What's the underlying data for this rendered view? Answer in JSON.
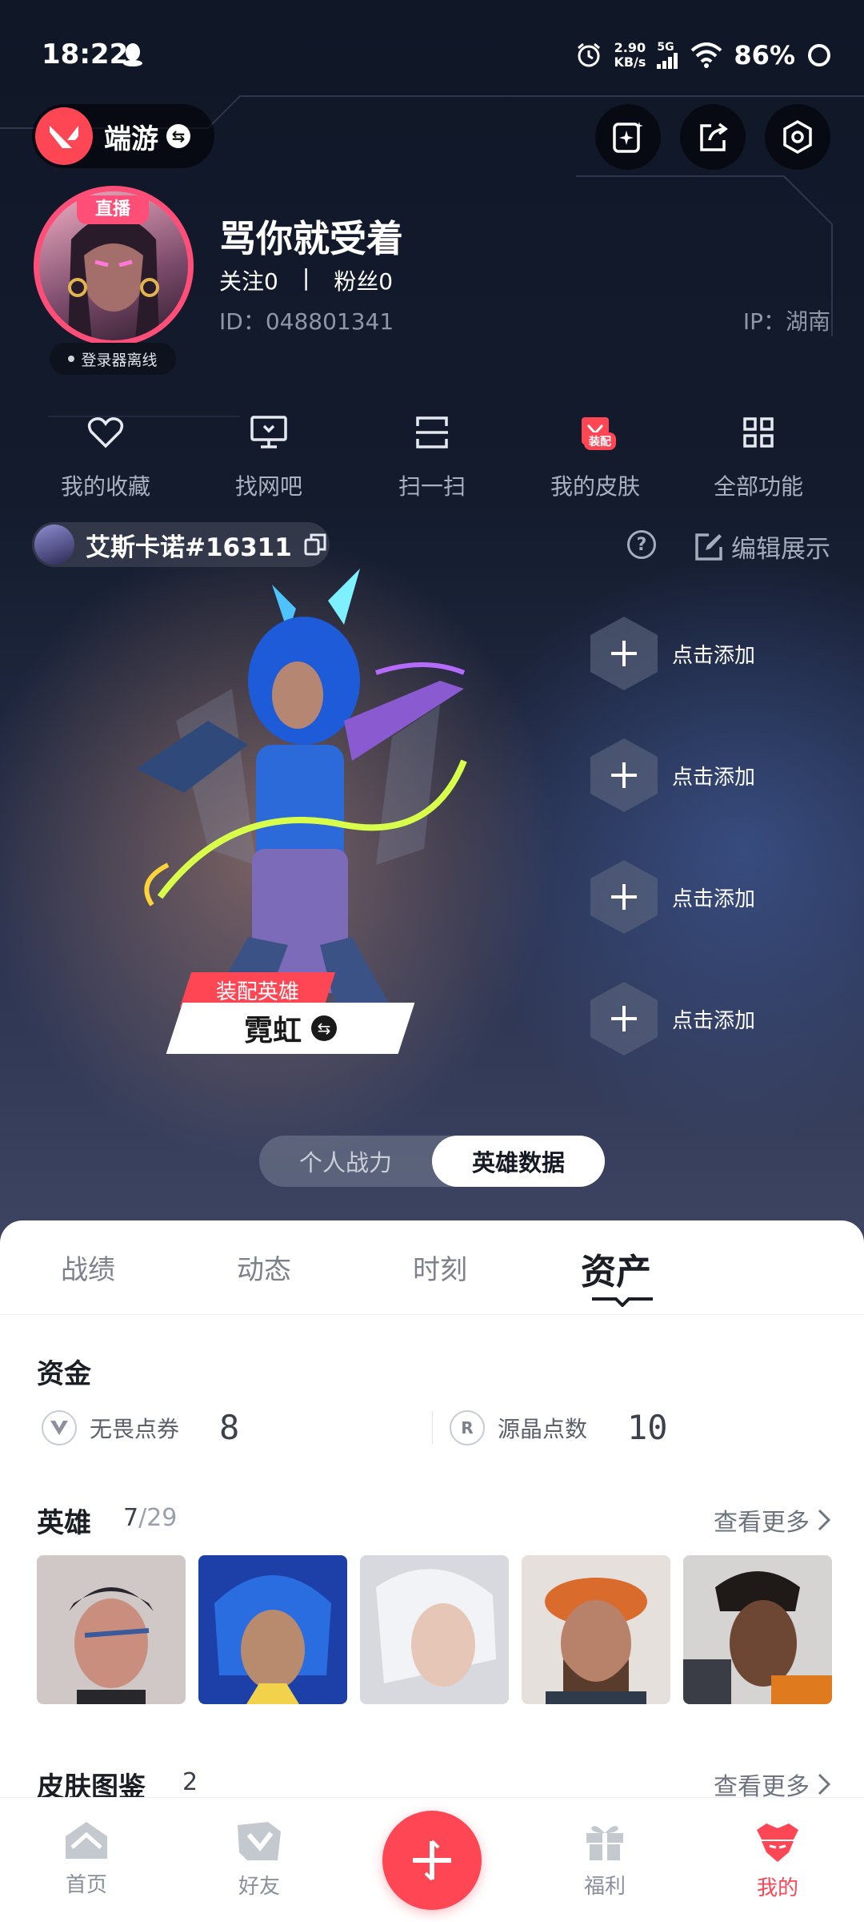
{
  "status_bar": {
    "time": "18:22",
    "speed_top": "2.90",
    "speed_unit": "KB/s",
    "network": "5G",
    "battery": "86%"
  },
  "header": {
    "app_name": "端游"
  },
  "profile": {
    "live_badge": "直播",
    "launcher_status": "登录器离线",
    "nickname": "骂你就受着",
    "following": "关注0",
    "separator": "|",
    "fans": "粉丝0",
    "uid": "ID：048801341",
    "ip": "IP：湖南"
  },
  "shortcuts": [
    {
      "label": "我的收藏",
      "icon": "heart-icon"
    },
    {
      "label": "找网吧",
      "icon": "monitor-icon"
    },
    {
      "label": "扫一扫",
      "icon": "scan-icon"
    },
    {
      "label": "我的皮肤",
      "icon": "skin-icon",
      "badge": "装配"
    },
    {
      "label": "全部功能",
      "icon": "grid-icon"
    }
  ],
  "account": {
    "riot_id": "艾斯卡诺#16311",
    "edit_label": "编辑展示"
  },
  "showcase": {
    "equip_label": "装配英雄",
    "agent_name": "霓虹",
    "slots": [
      "点击添加",
      "点击添加",
      "点击添加",
      "点击添加"
    ]
  },
  "toggle": {
    "left": "个人战力",
    "right": "英雄数据"
  },
  "tabs": [
    "战绩",
    "动态",
    "时刻",
    "资产"
  ],
  "assets": {
    "funds_title": "资金",
    "funds": [
      {
        "icon": "valorant-points-icon",
        "label": "无畏点券",
        "value": "8"
      },
      {
        "icon": "radianite-icon",
        "label": "源晶点数",
        "value": "10"
      }
    ],
    "heroes_title": "英雄",
    "heroes_owned": "7",
    "heroes_sep": "/",
    "heroes_total": "29",
    "more_label": "查看更多",
    "skins_title": "皮肤图鉴",
    "skins_count": "2"
  },
  "bottom_nav": [
    {
      "label": "首页",
      "icon": "home-icon"
    },
    {
      "label": "好友",
      "icon": "friends-icon"
    },
    {
      "label": "福利",
      "icon": "gift-icon"
    },
    {
      "label": "我的",
      "icon": "profile-icon"
    }
  ],
  "colors": {
    "accent": "#ff4655",
    "live": "#ff4f79",
    "dark_bg": "#101727"
  }
}
